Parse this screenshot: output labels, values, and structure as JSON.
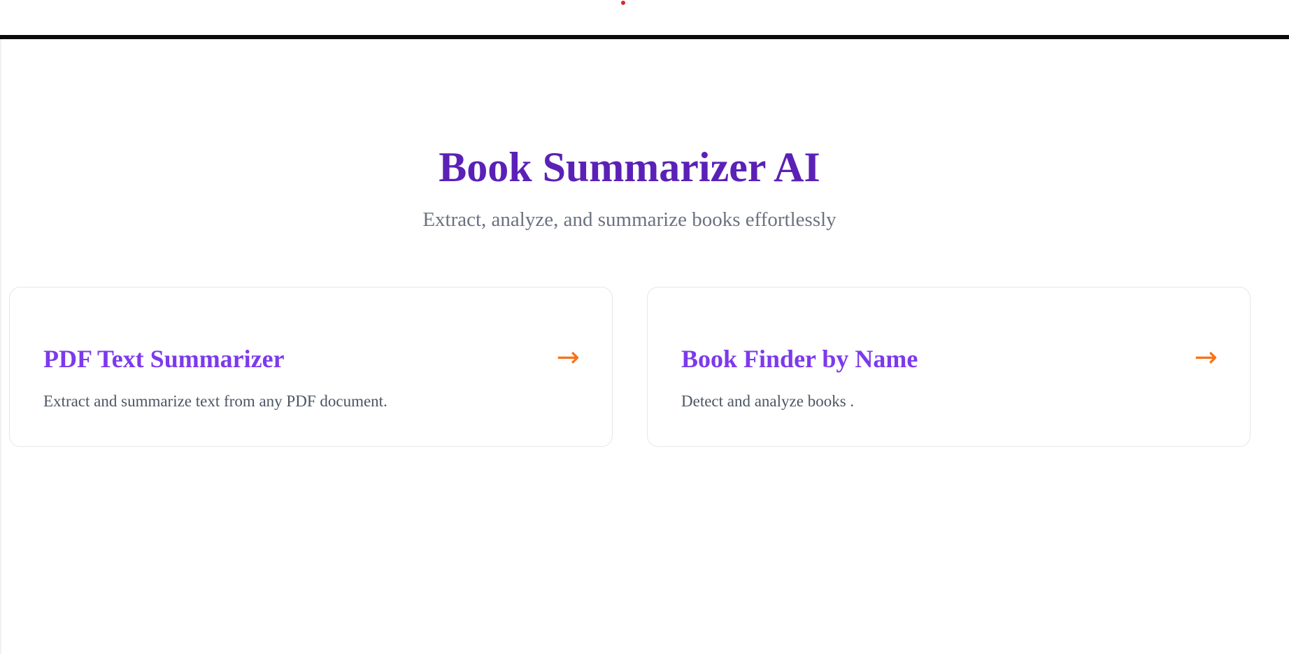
{
  "header": {
    "title": "Book Summarizer AI",
    "subtitle": "Extract, analyze, and summarize books effortlessly"
  },
  "cards": [
    {
      "title": "PDF Text Summarizer",
      "description": "Extract and summarize text from any PDF document.",
      "arrow": "→",
      "icon": "arrow-right-icon"
    },
    {
      "title": "Book Finder by Name",
      "description": "Detect and analyze books .",
      "arrow": "→",
      "icon": "arrow-right-icon"
    }
  ],
  "colors": {
    "title": "#5b21b6",
    "card_title": "#7c3aed",
    "accent_arrow": "#f97316",
    "subtitle": "#6b7280",
    "card_border": "#e5e7eb"
  }
}
